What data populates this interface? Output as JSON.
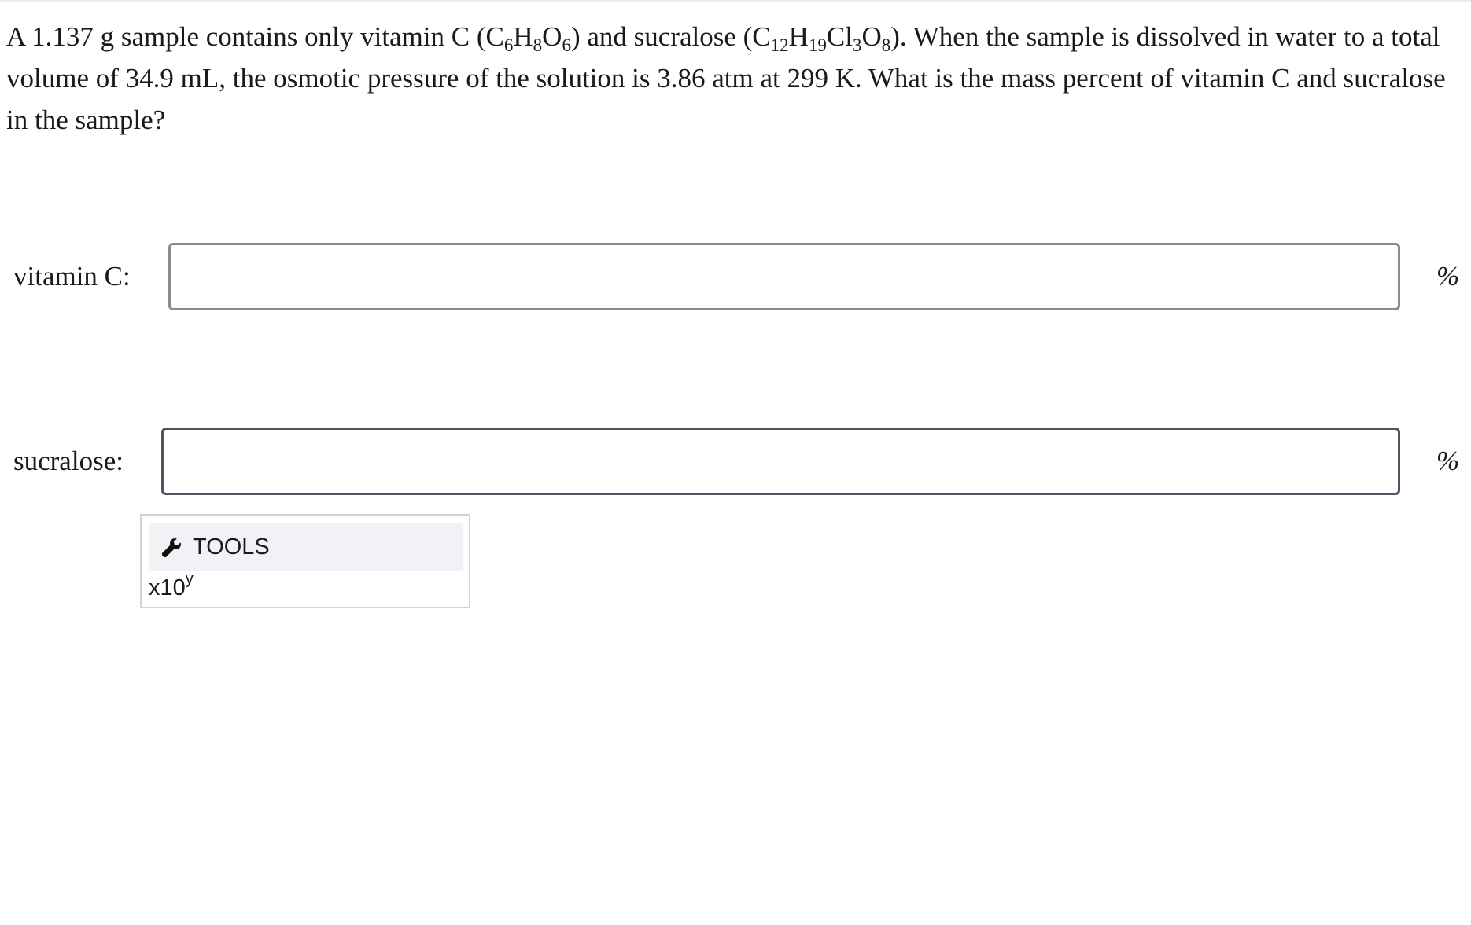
{
  "question": {
    "p1": "A 1.137 g sample contains only vitamin C (C",
    "vc_c": "6",
    "vc_h_el": "H",
    "vc_h": "8",
    "vc_o_el": "O",
    "vc_o": "6",
    "p2": ") and sucralose (C",
    "su_c": "12",
    "su_h_el": "H",
    "su_h": "19",
    "su_cl_el": "Cl",
    "su_cl": "3",
    "su_o_el": "O",
    "su_o": "8",
    "p3": "). When the sample is dissolved in water to a total volume of 34.9 mL, the osmotic pressure of the solution is 3.86 atm at 299 K. What is the mass percent of vitamin C and sucralose in the sample?"
  },
  "answers": [
    {
      "label": "vitamin C:",
      "value": "",
      "unit": "%"
    },
    {
      "label": "sucralose:",
      "value": "",
      "unit": "%"
    }
  ],
  "tools": {
    "header_label": "TOOLS",
    "icon": "wrench-icon",
    "sci_notation_base": "x10",
    "sci_notation_exp": "y"
  }
}
